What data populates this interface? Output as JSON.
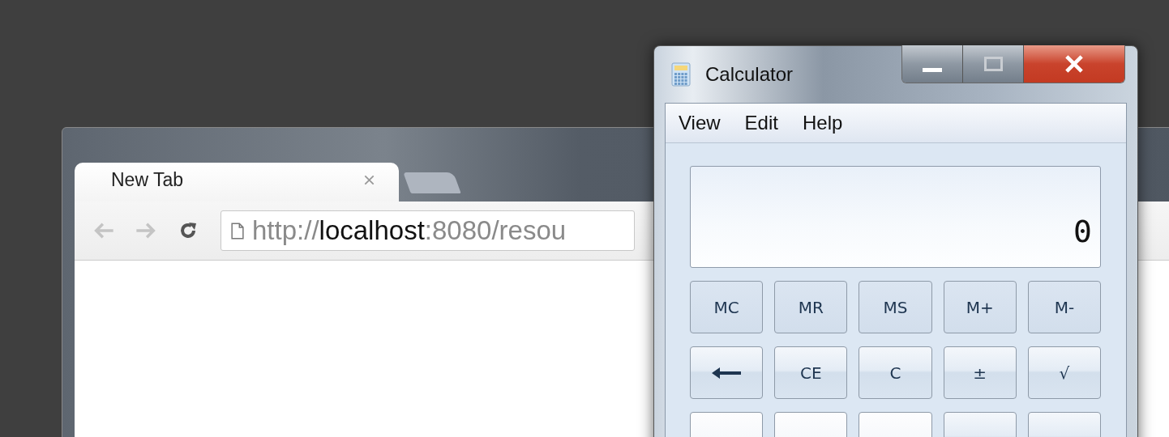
{
  "browser": {
    "tabs": [
      {
        "title": "New Tab",
        "selected": true
      }
    ],
    "address": {
      "scheme": "http://",
      "host": "localhost",
      "rest": ":8080/resou"
    }
  },
  "calculator": {
    "title": "Calculator",
    "menu": [
      "View",
      "Edit",
      "Help"
    ],
    "display": "0",
    "key_rows": [
      [
        {
          "kind": "memory",
          "label": "MC"
        },
        {
          "kind": "memory",
          "label": "MR"
        },
        {
          "kind": "memory",
          "label": "MS"
        },
        {
          "kind": "memory",
          "label": "M+"
        },
        {
          "kind": "memory",
          "label": "M-"
        }
      ],
      [
        {
          "kind": "backspace"
        },
        {
          "kind": "function",
          "label": "CE"
        },
        {
          "kind": "function",
          "label": "C"
        },
        {
          "kind": "function",
          "label": "±"
        },
        {
          "kind": "function",
          "label": "√"
        }
      ],
      [
        {
          "kind": "digit"
        },
        {
          "kind": "digit"
        },
        {
          "kind": "digit"
        },
        {
          "kind": "function"
        },
        {
          "kind": "function"
        }
      ]
    ]
  }
}
